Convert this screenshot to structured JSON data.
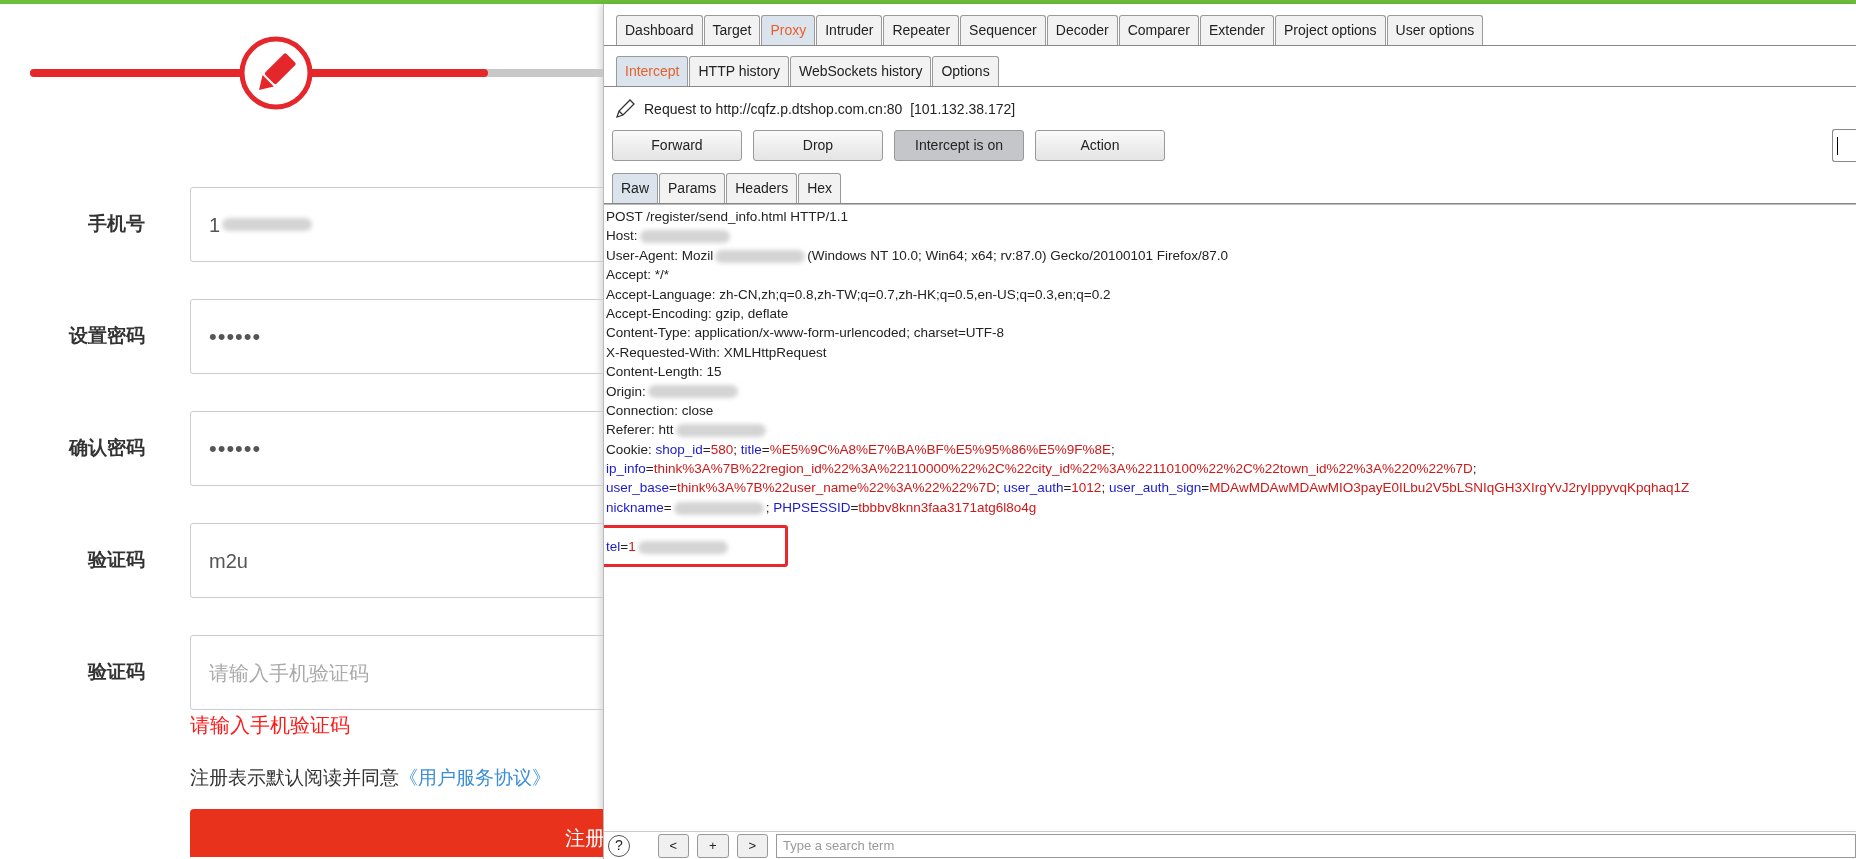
{
  "form_page": {
    "progress": {
      "level": 0.8
    },
    "fields": [
      {
        "label": "手机号",
        "kind": "text",
        "value": "1",
        "redacted": true
      },
      {
        "label": "设置密码",
        "kind": "password",
        "value": "••••••",
        "redacted": false
      },
      {
        "label": "确认密码",
        "kind": "password",
        "value": "••••••",
        "redacted": false
      },
      {
        "label": "验证码",
        "kind": "text",
        "value": "m2u",
        "redacted": false
      },
      {
        "label": "验证码",
        "kind": "text",
        "placeholder": "请输入手机验证码",
        "redacted": false
      }
    ],
    "error": "请输入手机验证码",
    "agreement": {
      "text": "注册表示默认阅读并同意",
      "link": "《用户服务协议》"
    },
    "submit": "注册"
  },
  "burp": {
    "main_tabs": [
      {
        "label": "Dashboard",
        "selected": false
      },
      {
        "label": "Target",
        "selected": false
      },
      {
        "label": "Proxy",
        "selected": true
      },
      {
        "label": "Intruder",
        "selected": false
      },
      {
        "label": "Repeater",
        "selected": false
      },
      {
        "label": "Sequencer",
        "selected": false
      },
      {
        "label": "Decoder",
        "selected": false
      },
      {
        "label": "Comparer",
        "selected": false
      },
      {
        "label": "Extender",
        "selected": false
      },
      {
        "label": "Project options",
        "selected": false
      },
      {
        "label": "User options",
        "selected": false
      }
    ],
    "sub_tabs": [
      {
        "label": "Intercept",
        "selected": true
      },
      {
        "label": "HTTP history",
        "selected": false
      },
      {
        "label": "WebSockets history",
        "selected": false
      },
      {
        "label": "Options",
        "selected": false
      }
    ],
    "request_target": "Request to http://cqfz.p.dtshop.com.cn:80  [101.132.38.172]",
    "buttons": [
      {
        "label": "Forward",
        "pressed": false
      },
      {
        "label": "Drop",
        "pressed": false
      },
      {
        "label": "Intercept is on",
        "pressed": true
      },
      {
        "label": "Action",
        "pressed": false
      }
    ],
    "editor_tabs": [
      {
        "label": "Raw",
        "selected": true
      },
      {
        "label": "Params",
        "selected": false
      },
      {
        "label": "Headers",
        "selected": false
      },
      {
        "label": "Hex",
        "selected": false
      }
    ],
    "request_lines": [
      {
        "kind": "text",
        "highlighted": false,
        "segments": [
          {
            "kind": "plain",
            "text": "POST /register/send_info.html HTTP/1.1"
          }
        ]
      },
      {
        "kind": "text",
        "highlighted": false,
        "segments": [
          {
            "kind": "plain",
            "text": "Host:"
          },
          {
            "kind": "redacted"
          }
        ]
      },
      {
        "kind": "text",
        "highlighted": false,
        "segments": [
          {
            "kind": "plain",
            "text": "User-Agent: Mozil"
          },
          {
            "kind": "redacted"
          },
          {
            "kind": "plain",
            "text": "(Windows NT 10.0; Win64; x64; rv:87.0) Gecko/20100101 Firefox/87.0"
          }
        ]
      },
      {
        "kind": "text",
        "highlighted": false,
        "segments": [
          {
            "kind": "plain",
            "text": "Accept: */*"
          }
        ]
      },
      {
        "kind": "text",
        "highlighted": false,
        "segments": [
          {
            "kind": "plain",
            "text": "Accept-Language: zh-CN,zh;q=0.8,zh-TW;q=0.7,zh-HK;q=0.5,en-US;q=0.3,en;q=0.2"
          }
        ]
      },
      {
        "kind": "text",
        "highlighted": false,
        "segments": [
          {
            "kind": "plain",
            "text": "Accept-Encoding: gzip, deflate"
          }
        ]
      },
      {
        "kind": "text",
        "highlighted": false,
        "segments": [
          {
            "kind": "plain",
            "text": "Content-Type: application/x-www-form-urlencoded; charset=UTF-8"
          }
        ]
      },
      {
        "kind": "text",
        "highlighted": false,
        "segments": [
          {
            "kind": "plain",
            "text": "X-Requested-With: XMLHttpRequest"
          }
        ]
      },
      {
        "kind": "text",
        "highlighted": false,
        "segments": [
          {
            "kind": "plain",
            "text": "Content-Length: 15"
          }
        ]
      },
      {
        "kind": "text",
        "highlighted": false,
        "segments": [
          {
            "kind": "plain",
            "text": "Origin:"
          },
          {
            "kind": "redacted"
          }
        ]
      },
      {
        "kind": "text",
        "highlighted": false,
        "segments": [
          {
            "kind": "plain",
            "text": "Connection: close"
          }
        ]
      },
      {
        "kind": "text",
        "highlighted": false,
        "segments": [
          {
            "kind": "plain",
            "text": "Referer: htt"
          },
          {
            "kind": "redacted"
          }
        ]
      },
      {
        "kind": "text",
        "highlighted": false,
        "segments": [
          {
            "kind": "plain",
            "text": "Cookie: "
          },
          {
            "kind": "name",
            "text": "shop_id"
          },
          {
            "kind": "plain",
            "text": "="
          },
          {
            "kind": "value",
            "text": "580"
          },
          {
            "kind": "plain",
            "text": "; "
          },
          {
            "kind": "name",
            "text": "title"
          },
          {
            "kind": "plain",
            "text": "="
          },
          {
            "kind": "value",
            "text": "%E5%9C%A8%E7%BA%BF%E5%95%86%E5%9F%8E"
          },
          {
            "kind": "plain",
            "text": ";"
          }
        ]
      },
      {
        "kind": "text",
        "highlighted": false,
        "segments": [
          {
            "kind": "name",
            "text": "ip_info"
          },
          {
            "kind": "plain",
            "text": "="
          },
          {
            "kind": "value",
            "text": "think%3A%7B%22region_id%22%3A%22110000%22%2C%22city_id%22%3A%22110100%22%2C%22town_id%22%3A%220%22%7D"
          },
          {
            "kind": "plain",
            "text": ";"
          }
        ]
      },
      {
        "kind": "text",
        "highlighted": false,
        "segments": [
          {
            "kind": "name",
            "text": "user_base"
          },
          {
            "kind": "plain",
            "text": "="
          },
          {
            "kind": "value",
            "text": "think%3A%7B%22user_name%22%3A%22%22%7D"
          },
          {
            "kind": "plain",
            "text": "; "
          },
          {
            "kind": "name",
            "text": "user_auth"
          },
          {
            "kind": "plain",
            "text": "="
          },
          {
            "kind": "value",
            "text": "1012"
          },
          {
            "kind": "plain",
            "text": "; "
          },
          {
            "kind": "name",
            "text": "user_auth_sign"
          },
          {
            "kind": "plain",
            "text": "="
          },
          {
            "kind": "value",
            "text": "MDAwMDAwMDAwMIO3payE0ILbu2V5bLSNIqGH3XIrgYvJ2ryIppyvqKpqhaq1Z"
          }
        ]
      },
      {
        "kind": "text",
        "highlighted": false,
        "segments": [
          {
            "kind": "name",
            "text": "nickname"
          },
          {
            "kind": "plain",
            "text": "="
          },
          {
            "kind": "redacted"
          },
          {
            "kind": "plain",
            "text": "; "
          },
          {
            "kind": "name",
            "text": "PHPSESSID"
          },
          {
            "kind": "plain",
            "text": "="
          },
          {
            "kind": "value",
            "text": "tbbbv8knn3faa3171atg6l8o4g"
          }
        ]
      },
      {
        "kind": "blank",
        "highlighted": false
      },
      {
        "kind": "text",
        "highlighted": true,
        "segments": [
          {
            "kind": "name",
            "text": "tel"
          },
          {
            "kind": "plain",
            "text": "="
          },
          {
            "kind": "value",
            "text": "1"
          },
          {
            "kind": "redacted"
          }
        ]
      }
    ],
    "bottom_bar": {
      "help": "?",
      "nav_buttons": [
        "<",
        "+",
        ">"
      ],
      "search_placeholder": "Type a search term"
    }
  }
}
